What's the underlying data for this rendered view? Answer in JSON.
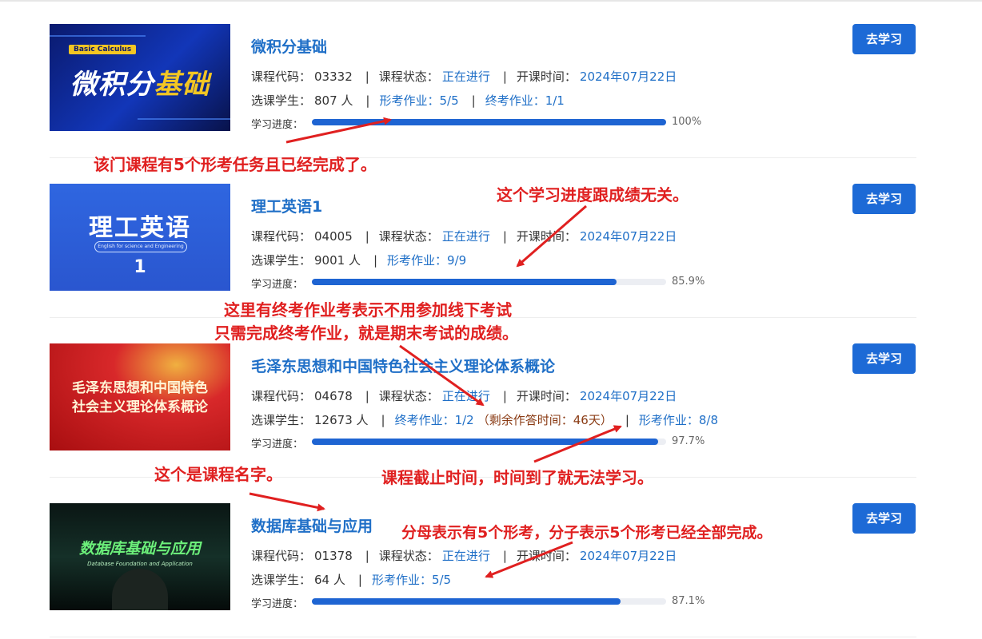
{
  "labels": {
    "code": "课程代码：",
    "status": "课程状态：",
    "start": "开课时间：",
    "students": "选课学生：",
    "progress": "学习进度：",
    "button": "去学习"
  },
  "courses": [
    {
      "title": "微积分基础",
      "thumb_badge": "Basic Calculus",
      "thumb_title_a": "微积分",
      "thumb_title_b": "基础",
      "code": "03332",
      "status": "正在进行",
      "start": "2024年07月22日",
      "students": "807 人",
      "assign1": "形考作业：5/5",
      "assign2": "终考作业：1/1",
      "progress_text": "100%",
      "progress": 1.0
    },
    {
      "title": "理工英语1",
      "thumb_title": "理工英语",
      "thumb_sub": "English for science and Engineering",
      "thumb_num": "1",
      "code": "04005",
      "status": "正在进行",
      "start": "2024年07月22日",
      "students": "9001 人",
      "assign1": "形考作业：9/9",
      "progress_text": "85.9%",
      "progress": 0.859
    },
    {
      "title": "毛泽东思想和中国特色社会主义理论体系概论",
      "thumb_line1": "毛泽东思想和中国特色",
      "thumb_line2": "社会主义理论体系概论",
      "code": "04678",
      "status": "正在进行",
      "start": "2024年07月22日",
      "students": "12673 人",
      "assign1": "终考作业：1/2",
      "remaining": "（剩余作答时间：46天）",
      "assign2": "形考作业：8/8",
      "progress_text": "97.7%",
      "progress": 0.977
    },
    {
      "title": "数据库基础与应用",
      "thumb_title": "数据库基础与应用",
      "thumb_sub": "Database Foundation and Application",
      "code": "01378",
      "status": "正在进行",
      "start": "2024年07月22日",
      "students": "64 人",
      "assign1": "形考作业：5/5",
      "progress_text": "87.1%",
      "progress": 0.871
    }
  ],
  "annotations": {
    "a1": "该门课程有5个形考任务且已经完成了。",
    "a2": "这个学习进度跟成绩无关。",
    "a3_line1": "这里有终考作业考表示不用参加线下考试",
    "a3_line2": "只需完成终考作业，就是期末考试的成绩。",
    "a4": "这个是课程名字。",
    "a5": "课程截止时间，时间到了就无法学习。",
    "a6": "分母表示有5个形考，分子表示5个形考已经全部完成。"
  },
  "colors": {
    "accent": "#1d6ad6",
    "link": "#1f6fc7",
    "annotation": "#e02020"
  }
}
